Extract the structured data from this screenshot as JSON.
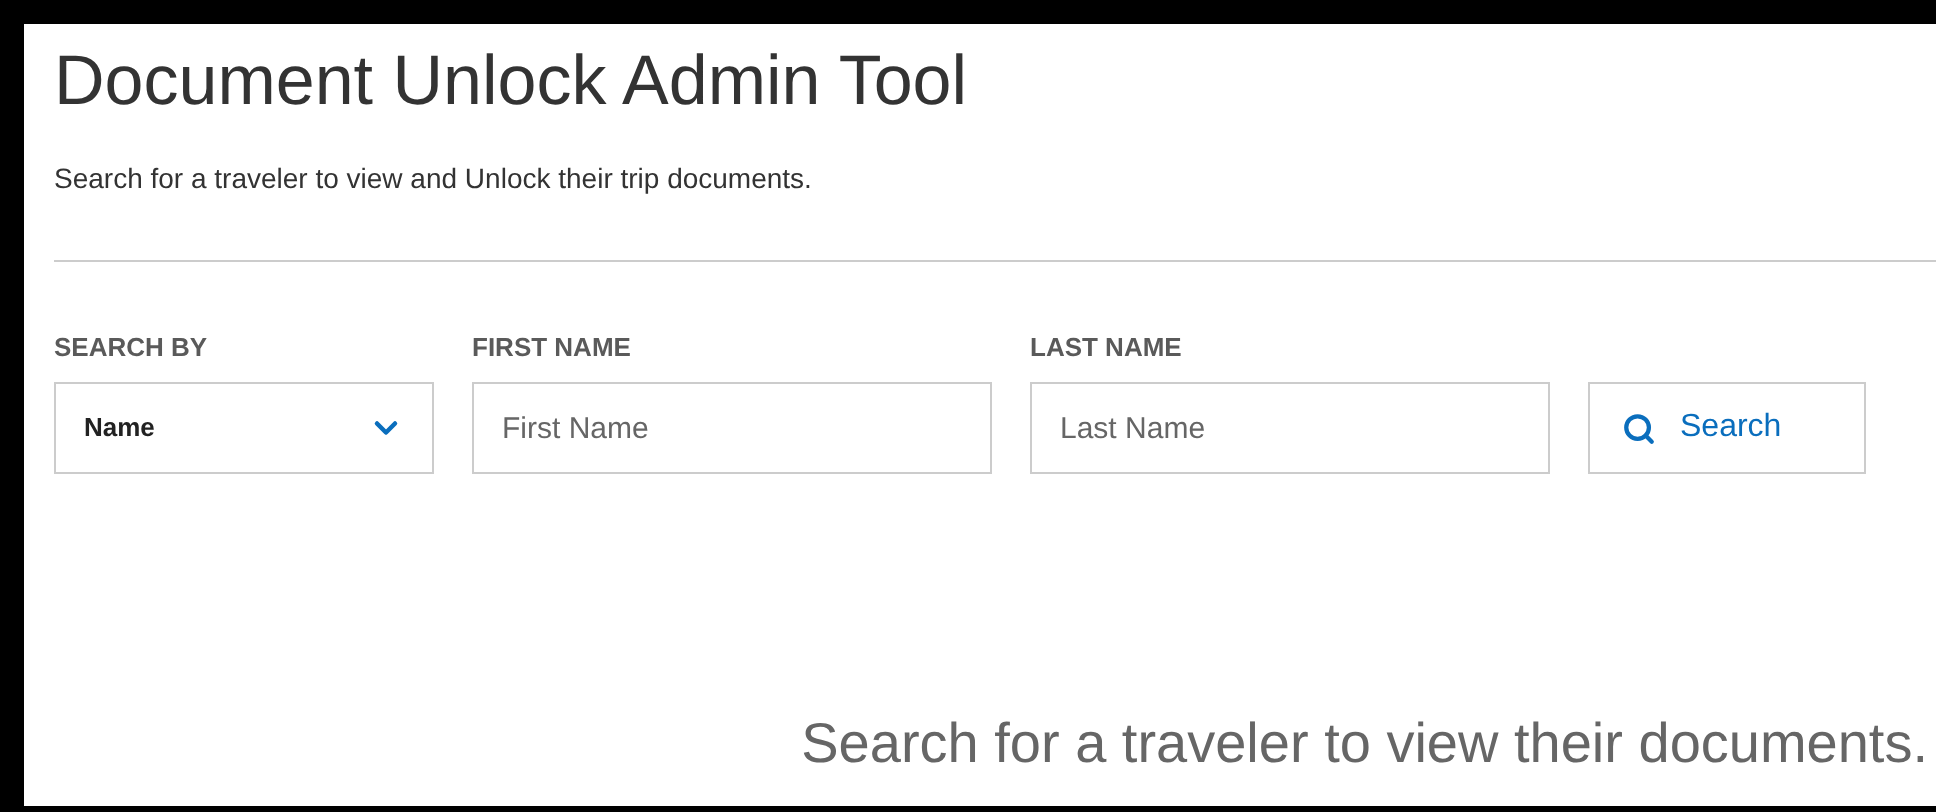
{
  "title": "Document Unlock Admin Tool",
  "subtitle": "Search for a traveler to view and Unlock their trip documents.",
  "search_form": {
    "search_by": {
      "label": "SEARCH BY",
      "value": "Name"
    },
    "first_name": {
      "label": "FIRST NAME",
      "placeholder": "First Name"
    },
    "last_name": {
      "label": "LAST NAME",
      "placeholder": "Last Name"
    },
    "search_button": "Search"
  },
  "empty_message": "Search for a traveler to view their documents."
}
